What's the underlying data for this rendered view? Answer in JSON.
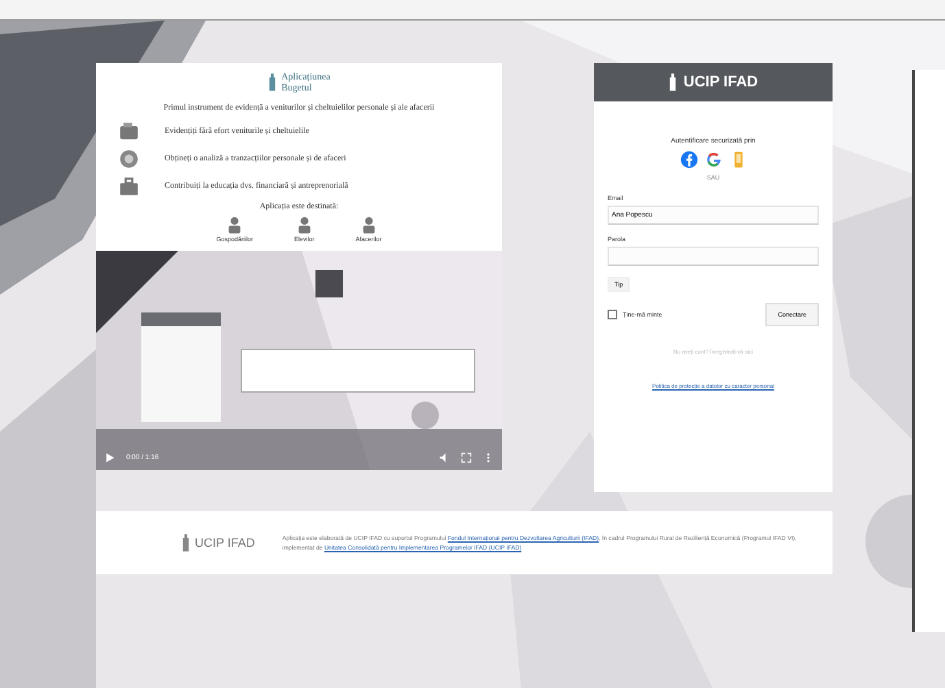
{
  "promo": {
    "logo_line_1": "Aplicațiunea",
    "logo_line_2": "Bugetul",
    "headline": "Primul instrument de evidență a veniturilor și cheltuielilor personale și ale afacerii",
    "features": [
      {
        "kind": "wallet",
        "text": "Evidențiți fără efort veniturile și cheltuielile"
      },
      {
        "kind": "chart",
        "text": "Obțineți o analiză a tranzacțiilor personale și de afaceri"
      },
      {
        "kind": "case",
        "text": "Contribuiți la educația dvs. financiară și antreprenorială"
      }
    ],
    "audience_title": "Aplicația este destinată:",
    "audiences": [
      {
        "label": "Gospodăriilor"
      },
      {
        "label": "Elevilor"
      },
      {
        "label": "Afacerilor"
      }
    ],
    "video": {
      "kind": "picture",
      "time": "0:00 / 1:16"
    }
  },
  "login": {
    "brand": "UCIP IFAD",
    "social_title": "Autentificare securizată prin",
    "or": "SAU",
    "email_label": "Email",
    "email_value": "Ana Popescu",
    "password_label": "Parola",
    "code_button": "Tip",
    "remember": {
      "label": "Ține-mă minte",
      "checked": false
    },
    "submit": "Conectare",
    "note": "Nu aveți cont? Înregistrați-vă aici",
    "policy_link": "Politica de protecție a datelor cu caracter personal"
  },
  "footer": {
    "brand": "UCIP IFAD",
    "text_1": "Aplicația este elaborată de UCIP IFAD cu suportul Programului ",
    "link_1": "Fondul Internațional pentru Dezvoltarea Agriculturii (IFAD)",
    "text_2": ", în cadrul Programului Rural de Reziliență Economică (Programul IFAD VI), implementat de ",
    "link_2": "Unitatea Consolidată pentru Implementarea Programelor IFAD (UCIP IFAD)"
  }
}
